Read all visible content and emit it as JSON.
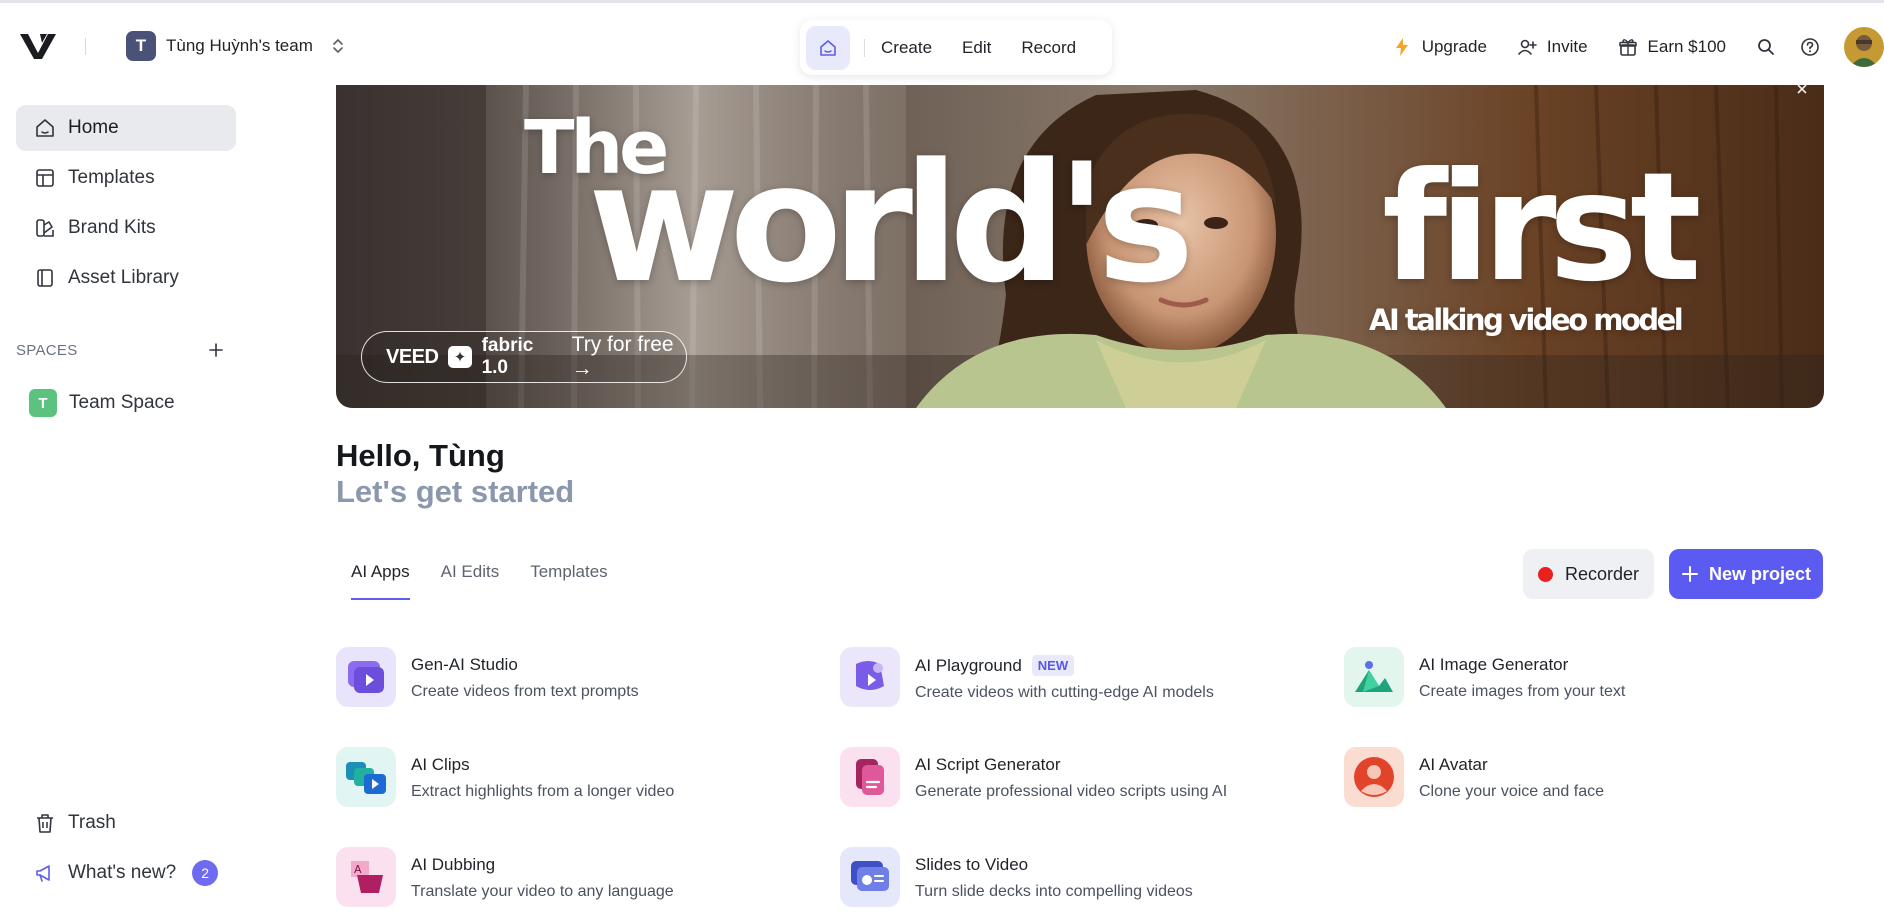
{
  "header": {
    "team_name": "Tùng Huỳnh's team",
    "team_initial": "T",
    "center_nav": [
      "Create",
      "Edit",
      "Record"
    ],
    "upgrade_label": "Upgrade",
    "invite_label": "Invite",
    "earn_label": "Earn $100"
  },
  "sidebar": {
    "items": [
      {
        "label": "Home",
        "icon": "home-icon"
      },
      {
        "label": "Templates",
        "icon": "templates-icon"
      },
      {
        "label": "Brand Kits",
        "icon": "brand-kit-icon"
      },
      {
        "label": "Asset Library",
        "icon": "library-icon"
      }
    ],
    "spaces_label": "SPACES",
    "space": {
      "initial": "T",
      "label": "Team Space"
    },
    "trash_label": "Trash",
    "whats_new_label": "What's new?",
    "whats_new_count": "2"
  },
  "banner": {
    "word_the": "The",
    "word_worlds": "world's",
    "word_first": "first",
    "tagline": "AI talking video model",
    "cta_brand": "VEED",
    "cta_product": "fabric 1.0",
    "cta_action": "Try for free →"
  },
  "greeting": {
    "hello": "Hello, Tùng",
    "subtitle": "Let's get started"
  },
  "tabs": [
    "AI Apps",
    "AI Edits",
    "Templates"
  ],
  "actions": {
    "recorder_label": "Recorder",
    "new_project_label": "New project"
  },
  "apps": [
    {
      "title": "Gen-AI Studio",
      "desc": "Create videos from text prompts",
      "icon": "gen-ai-studio-icon"
    },
    {
      "title": "AI Playground",
      "desc": "Create videos with cutting-edge AI models",
      "tag": "NEW",
      "icon": "ai-playground-icon"
    },
    {
      "title": "AI Image Generator",
      "desc": "Create images from your text",
      "icon": "image-generator-icon"
    },
    {
      "title": "AI Clips",
      "desc": "Extract highlights from a longer video",
      "icon": "ai-clips-icon"
    },
    {
      "title": "AI Script Generator",
      "desc": "Generate professional video scripts using AI",
      "icon": "script-generator-icon"
    },
    {
      "title": "AI Avatar",
      "desc": "Clone your voice and face",
      "icon": "ai-avatar-icon"
    },
    {
      "title": "AI Dubbing",
      "desc": "Translate your video to any language",
      "icon": "ai-dubbing-icon"
    },
    {
      "title": "Slides to Video",
      "desc": "Turn slide decks into compelling videos",
      "icon": "slides-to-video-icon"
    }
  ],
  "colors": {
    "accent": "#5b5bf2",
    "record_red": "#e8211d",
    "muted_heading": "#8a97ad"
  }
}
